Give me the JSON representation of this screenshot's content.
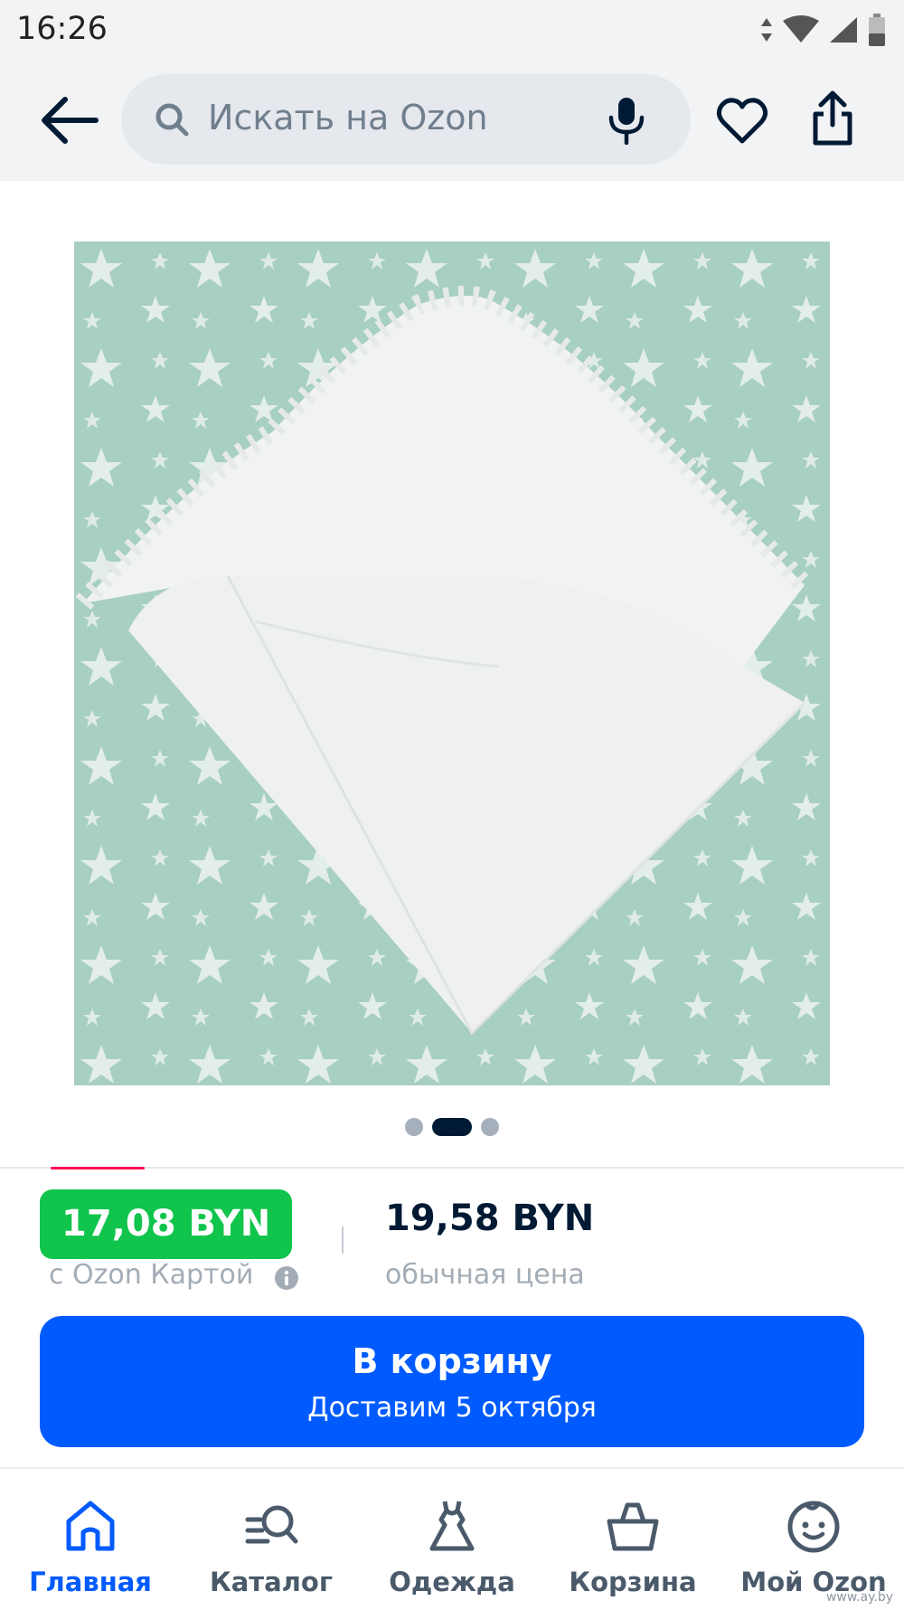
{
  "status_bar": {
    "time": "16:26"
  },
  "header": {
    "search_placeholder": "Искать на Ozon",
    "icons": [
      "back-arrow-icon",
      "search-icon",
      "microphone-icon",
      "heart-icon",
      "share-icon"
    ]
  },
  "gallery": {
    "image_count": 3,
    "active_index": 1
  },
  "price": {
    "ozon_card_price": "17,08 BYN",
    "ozon_card_label": "с Ozon Картой",
    "regular_price": "19,58 BYN",
    "regular_label": "обычная цена"
  },
  "cart_button": {
    "title": "В корзину",
    "subtitle": "Доставим 5 октября"
  },
  "nav": [
    {
      "label": "Главная",
      "icon": "home-icon",
      "active": true
    },
    {
      "label": "Каталог",
      "icon": "catalog-search-icon",
      "active": false
    },
    {
      "label": "Одежда",
      "icon": "dress-icon",
      "active": false
    },
    {
      "label": "Корзина",
      "icon": "basket-icon",
      "active": false
    },
    {
      "label": "Мой Ozon",
      "icon": "smile-icon",
      "active": false
    }
  ],
  "watermark": "www.ay.by",
  "colors": {
    "accent_blue": "#005bff",
    "price_green": "#10c44c",
    "text_dark": "#001a34",
    "muted": "#a3acb6"
  }
}
